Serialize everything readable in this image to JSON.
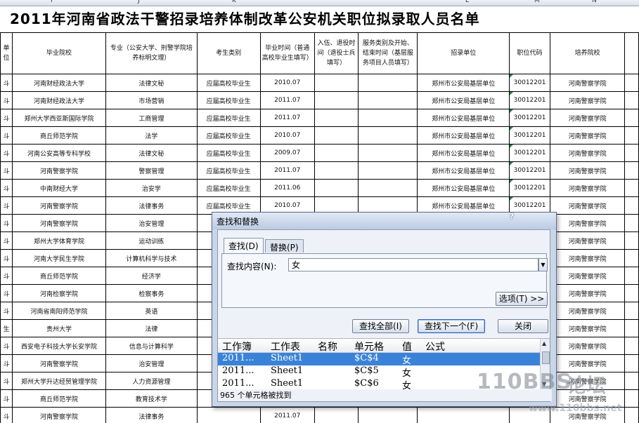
{
  "sheet": {
    "col_letters": [
      "I",
      "J",
      "K",
      "L",
      "M",
      "N"
    ],
    "title": "2011年河南省政法干警招录培养体制改革公安机关职位拟录取人员名单",
    "headers": [
      "单位",
      "毕业院校",
      "专业（公安大学、刑警学院培养标明文理）",
      "考生类别",
      "毕业时间（普通高校毕业生填写）",
      "入伍、退役时间（退役士兵填写）",
      "服务类别及开始、结束时间（基层服务项目人员填写）",
      "招录单位",
      "职位代码",
      "培养院校"
    ],
    "rows": [
      [
        "斗",
        "河南财经政法大学",
        "法律文秘",
        "应届高校毕业生",
        "2010.07",
        "",
        "",
        "郑州市公安局基层单位",
        "30012201",
        "河南警察学院"
      ],
      [
        "斗",
        "河南财经政法大学",
        "市场营销",
        "应届高校毕业生",
        "2011.07",
        "",
        "",
        "郑州市公安局基层单位",
        "30012201",
        "河南警察学院"
      ],
      [
        "斗",
        "郑州大学西亚斯国际学院",
        "工商管理",
        "应届高校毕业生",
        "2011.07",
        "",
        "",
        "郑州市公安局基层单位",
        "30012201",
        "河南警察学院"
      ],
      [
        "斗",
        "商丘师范学院",
        "法学",
        "应届高校毕业生",
        "2010.07",
        "",
        "",
        "郑州市公安局基层单位",
        "30012201",
        "河南警察学院"
      ],
      [
        "斗",
        "河南公安高等专科学校",
        "法律文秘",
        "应届高校毕业生",
        "2009.07",
        "",
        "",
        "郑州市公安局基层单位",
        "30012201",
        "河南警察学院"
      ],
      [
        "斗",
        "河南警察学院",
        "警察管理",
        "应届高校毕业生",
        "2011.07",
        "",
        "",
        "郑州市公安局基层单位",
        "30012201",
        "河南警察学院"
      ],
      [
        "斗",
        "中南财经大学",
        "治安学",
        "应届高校毕业生",
        "2011.06",
        "",
        "",
        "郑州市公安局基层单位",
        "30012201",
        "河南警察学院"
      ],
      [
        "斗",
        "河南警察学院",
        "法律事务",
        "应届高校毕业生",
        "2010.07",
        "",
        "",
        "郑州市公安局基层单位",
        "30012201",
        "河南警察学院"
      ],
      [
        "斗",
        "河南警察学院",
        "治安管理",
        "",
        "",
        "",
        "",
        "",
        "",
        "河南警察学院"
      ],
      [
        "斗",
        "郑州大学体育学院",
        "运动训练",
        "",
        "",
        "",
        "",
        "",
        "",
        "河南警察学院"
      ],
      [
        "斗",
        "河南大学民生学院",
        "计算机科学与技术",
        "",
        "",
        "",
        "",
        "",
        "",
        "河南警察学院"
      ],
      [
        "斗",
        "商丘师范学院",
        "经济学",
        "",
        "",
        "",
        "",
        "",
        "",
        "河南警察学院"
      ],
      [
        "斗",
        "河南检察学院",
        "检察事务",
        "",
        "",
        "",
        "",
        "",
        "",
        "河南警察学院"
      ],
      [
        "斗",
        "河南省南阳师范学院",
        "英语",
        "",
        "",
        "",
        "",
        "",
        "",
        "河南警察学院"
      ],
      [
        "生",
        "贵州大学",
        "法律",
        "",
        "",
        "",
        "",
        "",
        "",
        "河南警察学院"
      ],
      [
        "斗",
        "西安电子科技大学长安学院",
        "信息与计算科学",
        "",
        "",
        "",
        "",
        "",
        "",
        "河南警察学院"
      ],
      [
        "斗",
        "河南警察学院",
        "治安管理",
        "",
        "",
        "",
        "",
        "",
        "",
        "河南警察学院"
      ],
      [
        "斗",
        "郑州大学升达经贸管理学院",
        "人力资源管理",
        "",
        "",
        "",
        "",
        "",
        "",
        "河南警察学院"
      ],
      [
        "斗",
        "商丘师范学院",
        "教育技术学",
        "",
        "",
        "",
        "",
        "",
        "",
        "河南警察学院"
      ],
      [
        "斗",
        "河南警察学院",
        "法律事务",
        "",
        "2011.07",
        "",
        "",
        "",
        "",
        "河南警察学院"
      ]
    ]
  },
  "dialog": {
    "title": "查找和替换",
    "help": "?",
    "tabs": [
      {
        "label": "查找(D)",
        "active": true
      },
      {
        "label": "替换(P)",
        "active": false
      }
    ],
    "find_label": "查找内容(N):",
    "find_value": "女",
    "options_button": "选项(T) >>",
    "find_all_button": "查找全部(I)",
    "find_next_button": "查找下一个(F)",
    "close_button": "关闭",
    "results": {
      "columns": [
        "工作簿",
        "工作表",
        "名称",
        "单元格",
        "值",
        "公式"
      ],
      "rows": [
        [
          "2011...",
          "Sheet1",
          "",
          "$C$4",
          "女",
          ""
        ],
        [
          "2011...",
          "Sheet1",
          "",
          "$C$5",
          "女",
          ""
        ],
        [
          "2011...",
          "Sheet1",
          "",
          "$C$6",
          "女",
          ""
        ]
      ],
      "selected_index": 0
    },
    "status": "965 个单元格被找到"
  },
  "watermark": {
    "logo": "110BBS",
    "luntan": "论坛",
    "url": "www.110bbs.net"
  }
}
